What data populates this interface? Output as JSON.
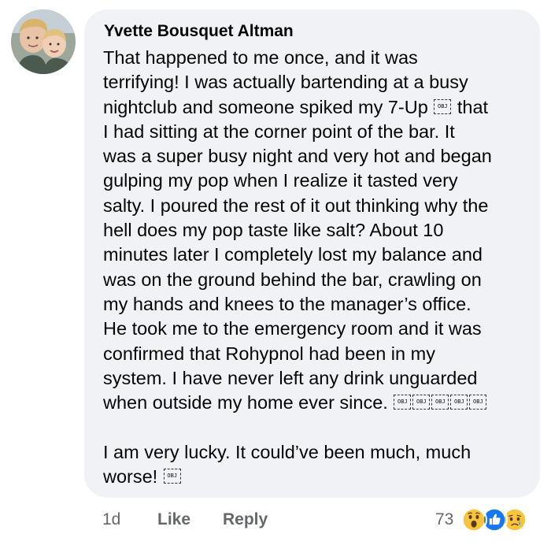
{
  "comment": {
    "author": "Yvette Bousquet Altman",
    "lines": [
      "That happened to me once, and it was",
      "terrifying! I was actually bartending at a busy",
      "nightclub and someone spiked my 7-Up",
      "that",
      "I had sitting at the corner point of the bar. It",
      "was a super busy night and very hot and began",
      "gulping my pop when I realize it tasted very",
      "salty. I poured the rest of it out thinking why the",
      "hell does my pop taste like salt? About 10",
      "minutes later I completely lost my balance and",
      "was on the ground behind the bar, crawling on",
      "my hands and knees to the manager’s office.",
      "He took me to the emergency room and it was",
      "confirmed that Rohypnol had been in my",
      "system. I have never left any drink unguarded",
      "when outside my home ever since.",
      "I am very lucky. It could’ve been much, much",
      "worse!"
    ],
    "obj_label": "OBJ"
  },
  "actions": {
    "time": "1d",
    "like_label": "Like",
    "reply_label": "Reply"
  },
  "reactions": {
    "count": "73",
    "icons": [
      "wow-reaction-icon",
      "like-reaction-icon",
      "sad-reaction-icon"
    ]
  },
  "colors": {
    "bubble": "#f0f2f5",
    "meta_text": "#65676b",
    "like_blue": "#1877f2",
    "emoji_yellow": "#f7c43c"
  }
}
